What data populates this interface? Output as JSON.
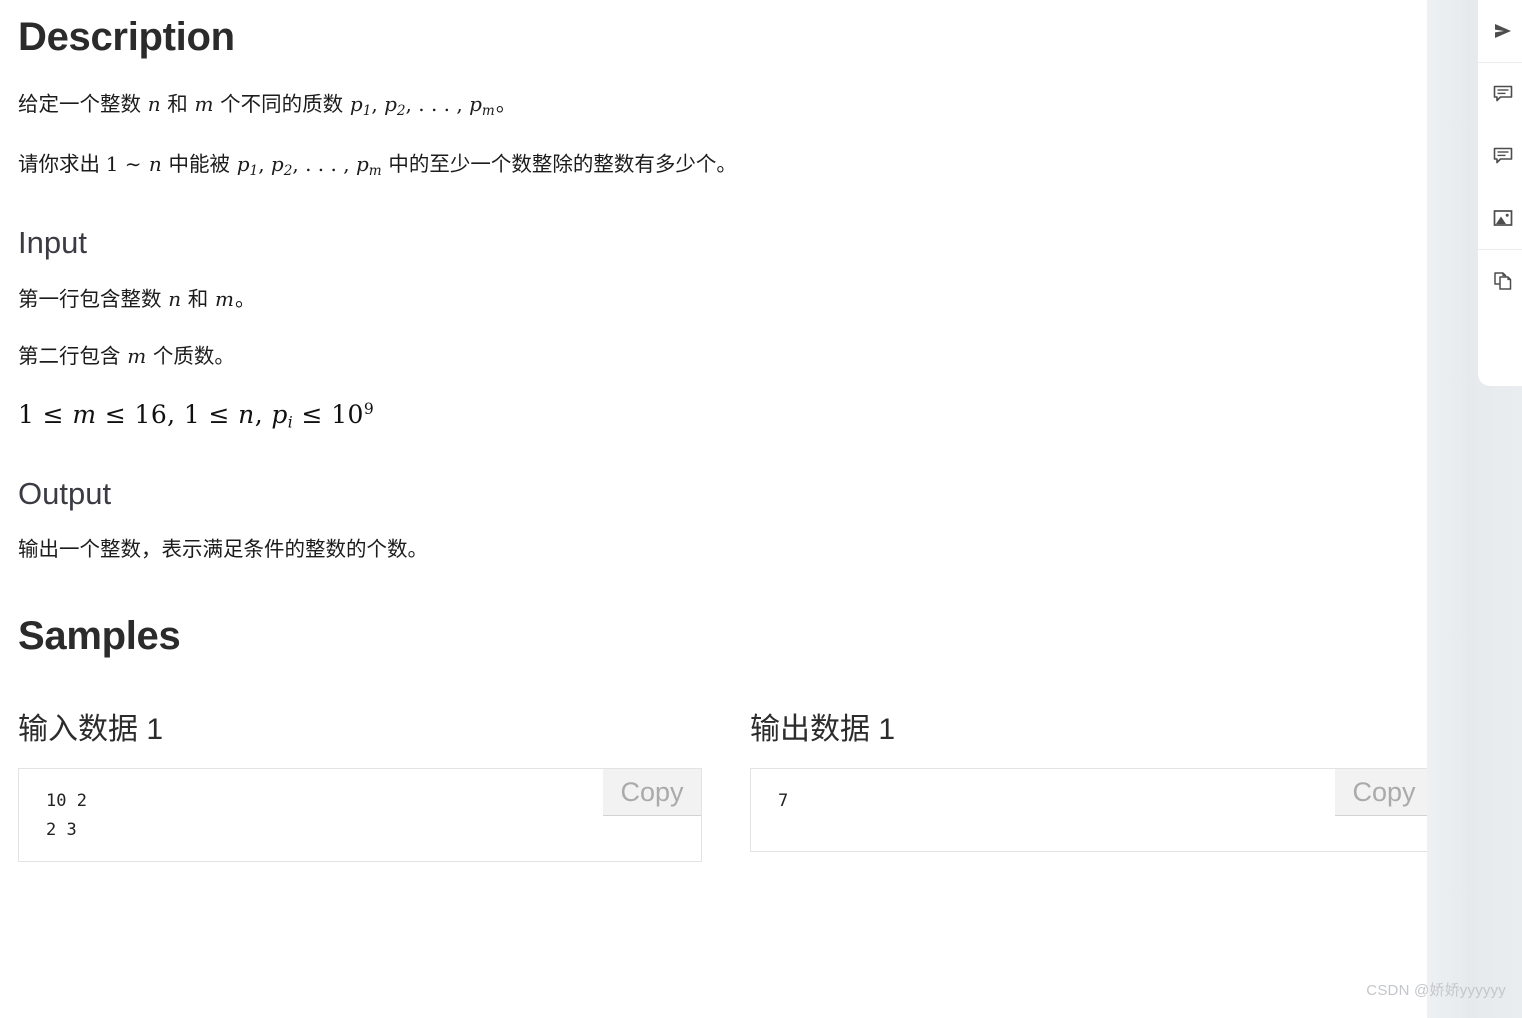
{
  "sections": {
    "description": {
      "heading": "Description",
      "paragraph1_prefix": "给定一个整数 ",
      "paragraph1_mid": " 和 ",
      "paragraph1_mid2": " 个不同的质数 ",
      "paragraph1_suffix": "。",
      "paragraph2_prefix": "请你求出 ",
      "paragraph2_mid": " 中能被 ",
      "paragraph2_suffix": " 中的至少一个数整除的整数有多少个。"
    },
    "input": {
      "heading": "Input",
      "line1_prefix": "第一行包含整数 ",
      "line1_mid": " 和 ",
      "line1_suffix": "。",
      "line2_prefix": "第二行包含 ",
      "line2_suffix": " 个质数。",
      "constraint": "1 ≤ m ≤ 16, 1 ≤ n, p_i ≤ 10^9"
    },
    "output": {
      "heading": "Output",
      "paragraph": "输出一个整数，表示满足条件的整数的个数。"
    },
    "samples": {
      "heading": "Samples",
      "input_title": "输入数据 1",
      "output_title": "输出数据 1",
      "input_value": "10 2\n2 3",
      "output_value": "7",
      "copy_label": "Copy"
    }
  },
  "math": {
    "n": "n",
    "m": "m",
    "one": "1",
    "tilde": "∼",
    "p_list": "p₁, p₂, . . . , p_m",
    "constraint_parts": {
      "a": "1 ≤ ",
      "b": "m",
      "c": " ≤ 16, 1 ≤ ",
      "d": "n",
      "e": ", ",
      "f": "p",
      "g": "i",
      "h": " ≤ 10",
      "i": "9"
    }
  },
  "tool_panel": {
    "items": [
      {
        "name": "send-icon",
        "title": "分享"
      },
      {
        "name": "comment-icon",
        "title": "评论"
      },
      {
        "name": "comment-alt-icon",
        "title": "讨论"
      },
      {
        "name": "image-icon",
        "title": "图片"
      },
      {
        "name": "copy-pages-icon",
        "title": "复制"
      }
    ]
  },
  "watermark": {
    "text": "CSDN @娇娇yyyyyy"
  },
  "colors": {
    "page_bg": "#ffffff",
    "rail_bg": "#e9edf0",
    "heading": "#2b2b2b",
    "subheading": "#3b3b44",
    "body_text": "#1c1c1c",
    "copy_btn_bg": "#f2f2f2",
    "copy_btn_text": "#aaaaaa",
    "box_border": "#e3e3e3",
    "watermark": "#c3c7cb"
  }
}
